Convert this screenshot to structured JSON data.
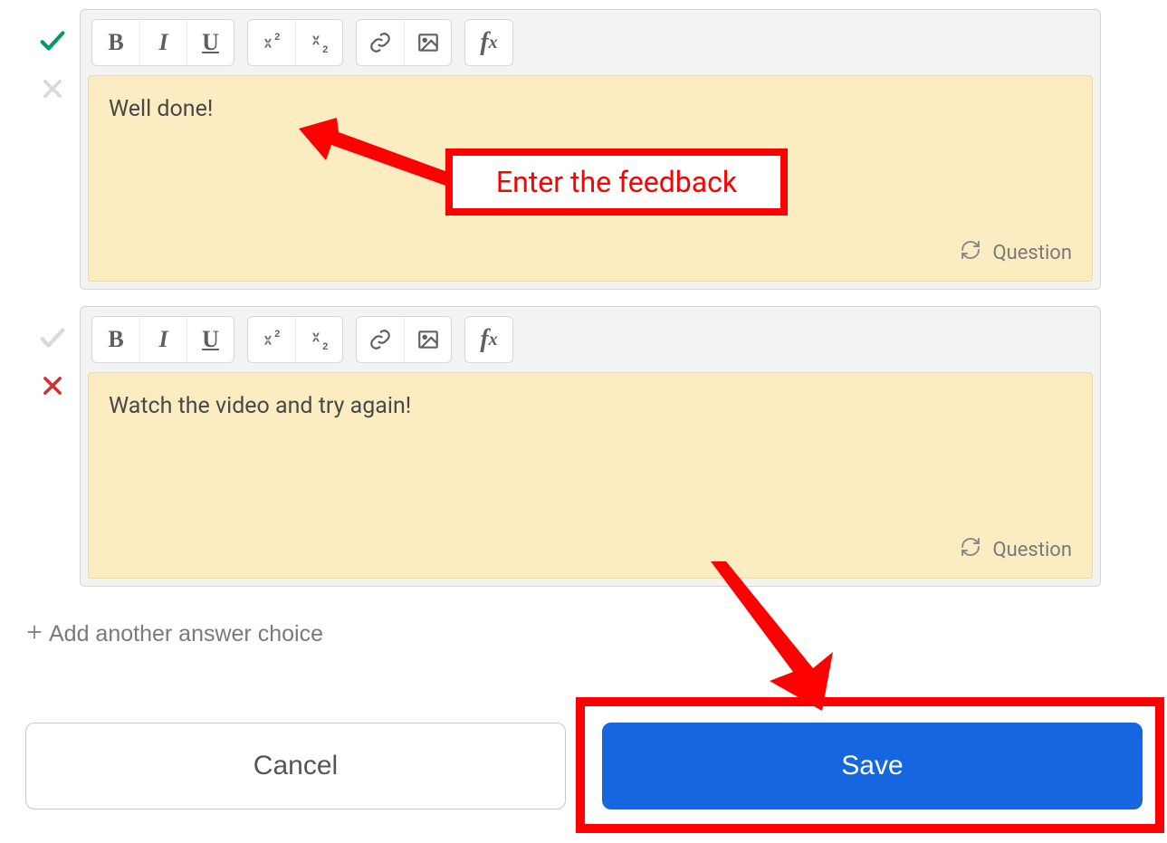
{
  "feedback": [
    {
      "content": "Well done!",
      "question_label": "Question"
    },
    {
      "content": "Watch the video and try again!",
      "question_label": "Question"
    }
  ],
  "add_choice_label": "Add another answer choice",
  "buttons": {
    "cancel": "Cancel",
    "save": "Save"
  },
  "annotation": {
    "hint": "Enter the feedback"
  }
}
